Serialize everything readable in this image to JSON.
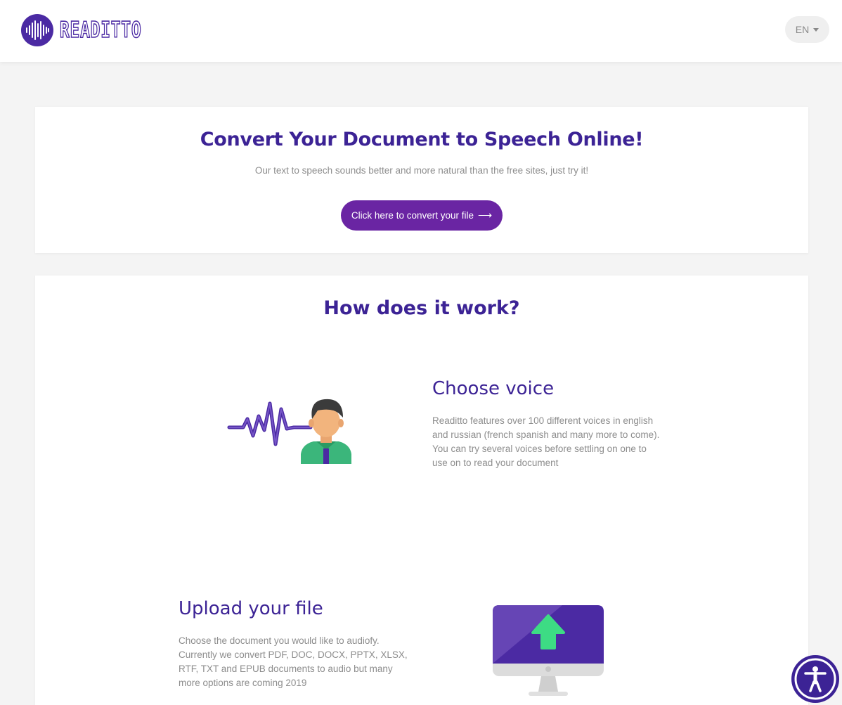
{
  "header": {
    "brand": "READITTO",
    "language": "EN"
  },
  "hero": {
    "title": "Convert Your Document to Speech Online!",
    "subtitle": "Our text to speech sounds better and more natural than the free sites, just try it!",
    "cta_label": "Click here to convert your file",
    "cta_arrow": "⟶"
  },
  "how": {
    "title": "How does it work?",
    "steps": [
      {
        "title": "Choose voice",
        "text": "Readitto features over 100 different voices in english and russian (french spanish and many more to come). You can try several voices before settling on one to use on to read your document",
        "icon": "voice-waveform-person-icon"
      },
      {
        "title": "Upload your file",
        "text": "Choose the document you would like to audiofy. Currently we convert PDF, DOC, DOCX, PPTX, XLSX, RTF, TXT and EPUB documents to audio but many more options are coming 2019",
        "icon": "monitor-upload-icon"
      }
    ]
  },
  "accessibility": {
    "icon": "accessibility-icon"
  },
  "colors": {
    "primary": "#3c2395",
    "cta": "#6a25a3",
    "upload_arrow": "#3ddc84"
  }
}
